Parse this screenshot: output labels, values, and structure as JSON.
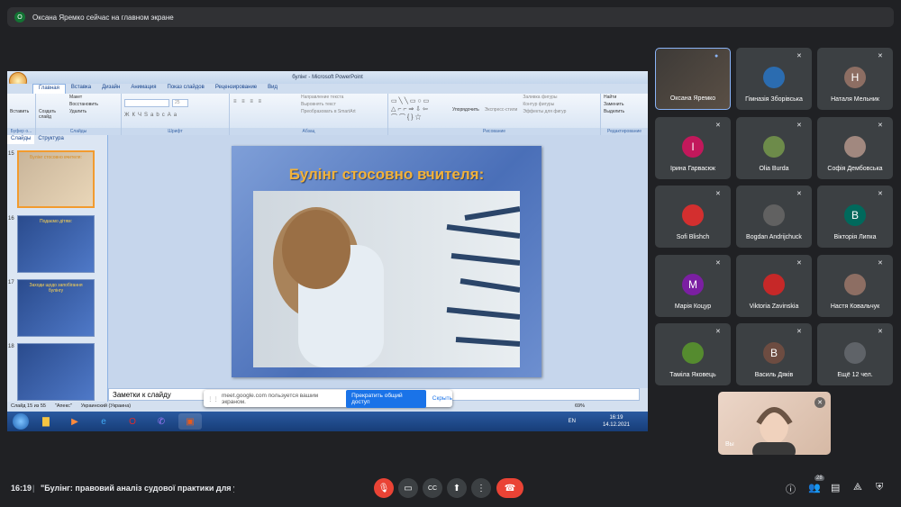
{
  "banner": {
    "avatar": "О",
    "text": "Оксана Яремко сейчас на главном экране"
  },
  "ppt": {
    "window_title": "булінг - Microsoft PowerPoint",
    "tabs": [
      "Главная",
      "Вставка",
      "Дизайн",
      "Анимация",
      "Показ слайдов",
      "Рецензирование",
      "Вид"
    ],
    "groups": {
      "clipboard": "Буфер о...",
      "slides": "Слайды",
      "font": "Шрифт",
      "paragraph": "Абзац",
      "drawing": "Рисование",
      "editing": "Редактирование"
    },
    "ribbon_items": {
      "paste": "Вставить",
      "create_slide": "Создать слайд",
      "layout": "Макет",
      "restore": "Восстановить",
      "delete": "Удалить",
      "text_direction": "Направление текста",
      "align_text": "Выровнять текст",
      "convert_smartart": "Преобразовать в SmartArt",
      "arrange": "Упорядочить",
      "quick_styles": "Экспресс-стили",
      "shape_fill": "Заливка фигуры",
      "shape_outline": "Контур фигуры",
      "shape_effects": "Эффекты для фигур",
      "find": "Найти",
      "replace": "Заменить",
      "select": "Выделить",
      "font_size": "25"
    },
    "pane_tabs": [
      "Слайды",
      "Структура"
    ],
    "thumbs": [
      {
        "num": "15",
        "title": "Булінг стосовно вчителя:"
      },
      {
        "num": "16",
        "title": "Подаємо дітям:"
      },
      {
        "num": "17",
        "title": "Заходи щодо запобігання булінгу"
      },
      {
        "num": "18",
        "title": ""
      }
    ],
    "slide_title": "Булінг стосовно вчителя:",
    "notes": "Заметки к слайду",
    "status": {
      "slide": "Слайд 15 из 55",
      "theme": "\"Апекс\"",
      "lang": "Украинский (Украина)",
      "zoom": "69%"
    },
    "taskbar": {
      "lang": "EN",
      "time": "16:19",
      "date": "14.12.2021"
    }
  },
  "sharebar": {
    "text": "meet.google.com пользуется вашим экраном.",
    "stop": "Прекратить общий доступ",
    "hide": "Скрыть"
  },
  "participants": [
    {
      "name": "Оксана Яремко",
      "initial": "",
      "color": "#6a5a4a",
      "video": true
    },
    {
      "name": "Гімназія Зборівська",
      "initial": "",
      "color": "#2b6cb0"
    },
    {
      "name": "Наталя Мельник",
      "initial": "Н",
      "color": "#8d6e63"
    },
    {
      "name": "Ірина Гарвасюк",
      "initial": "І",
      "color": "#c2185b"
    },
    {
      "name": "Olia Burda",
      "initial": "",
      "color": "#6d8b4a"
    },
    {
      "name": "Софія Дембовська",
      "initial": "",
      "color": "#a1887f"
    },
    {
      "name": "Sofi Blishch",
      "initial": "",
      "color": "#d32f2f"
    },
    {
      "name": "Bogdan Andrijchuck",
      "initial": "",
      "color": "#616161"
    },
    {
      "name": "Вікторія Липка",
      "initial": "В",
      "color": "#00695c"
    },
    {
      "name": "Марія Коцур",
      "initial": "М",
      "color": "#7b1fa2"
    },
    {
      "name": "Viktoria Zavinskia",
      "initial": "",
      "color": "#c62828"
    },
    {
      "name": "Настя Ковальчук",
      "initial": "",
      "color": "#8d6e63"
    },
    {
      "name": "Таміла Яковець",
      "initial": "",
      "color": "#558b2f"
    },
    {
      "name": "Василь Дяків",
      "initial": "В",
      "color": "#6d4c41"
    },
    {
      "name": "Ещё 12 чел.",
      "initial": "",
      "color": "#5f6368"
    }
  ],
  "self": {
    "label": "Вы"
  },
  "bottom": {
    "time": "16:19",
    "separator": "|",
    "meeting": "\"Булінг: правовий аналіз судової практики для уч...",
    "people_count": "28"
  },
  "colors": {
    "end_call": "#ea4335",
    "mic_off": "#ea4335",
    "accent": "#1a73e8"
  }
}
